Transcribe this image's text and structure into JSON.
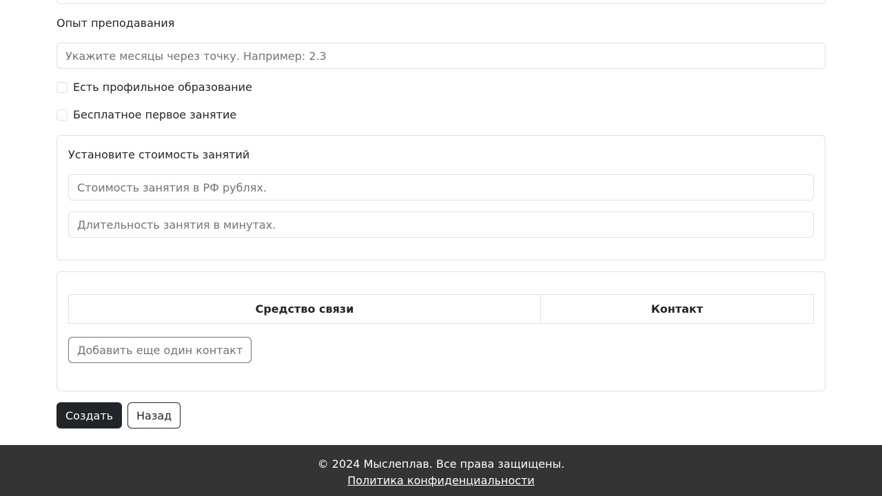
{
  "form": {
    "experience_label": "Опыт преподавания",
    "experience_placeholder": "Укажите месяцы через точку. Например: 2.3",
    "has_education_label": "Есть профильное образование",
    "free_first_lesson_label": "Бесплатное первое занятие"
  },
  "pricing": {
    "title": "Установите стоимость занятий",
    "price_placeholder": "Стоимость занятия в РФ рублях.",
    "duration_placeholder": "Длительность занятия в минутах."
  },
  "contacts": {
    "columns": [
      "Средство связи",
      "Контакт"
    ],
    "add_button": "Добавить еще один контакт"
  },
  "actions": {
    "create": "Создать",
    "back": "Назад"
  },
  "footer": {
    "copyright": "© 2024 Мыслеплав. Все права защищены.",
    "privacy_link": "Политика конфиденциальности"
  }
}
